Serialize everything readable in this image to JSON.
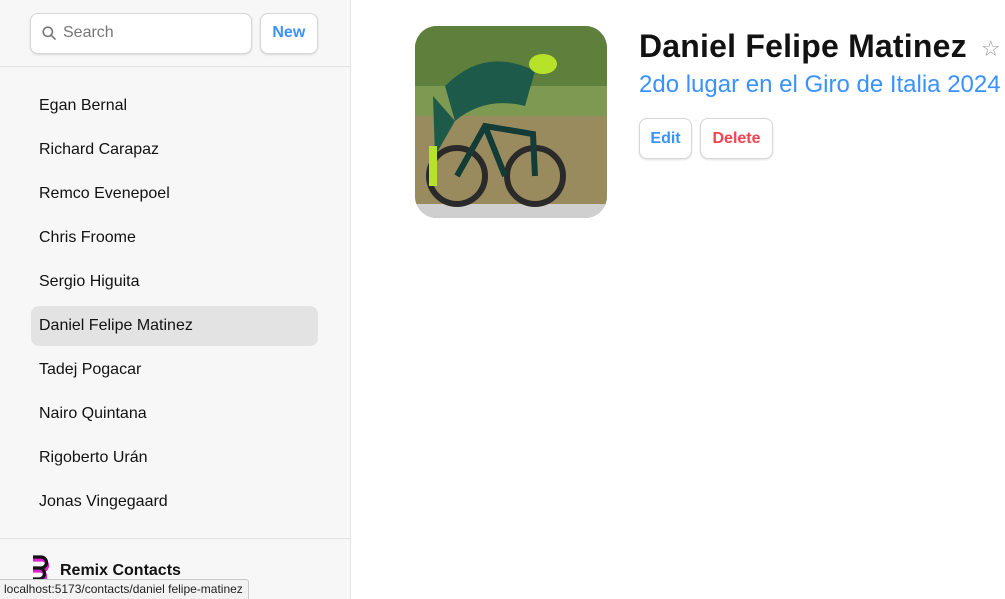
{
  "search": {
    "placeholder": "Search",
    "icon": "search-icon"
  },
  "buttons": {
    "new_label": "New",
    "edit_label": "Edit",
    "delete_label": "Delete"
  },
  "contacts": [
    {
      "name": "Egan Bernal"
    },
    {
      "name": "Richard Carapaz"
    },
    {
      "name": "Remco Evenepoel"
    },
    {
      "name": "Chris Froome"
    },
    {
      "name": "Sergio Higuita"
    },
    {
      "name": "Daniel Felipe Matinez",
      "active": true
    },
    {
      "name": "Tadej Pogacar"
    },
    {
      "name": "Nairo Quintana"
    },
    {
      "name": "Rigoberto Urán"
    },
    {
      "name": "Jonas Vingegaard"
    }
  ],
  "footer": {
    "brand": "Remix Contacts"
  },
  "detail": {
    "name": "Daniel Felipe Matinez",
    "subtitle": "2do lugar en el Giro de Italia 2024",
    "favorite_glyph": "☆"
  },
  "status_bar": {
    "url": "localhost:5173/contacts/daniel felipe-matinez"
  },
  "colors": {
    "accent": "#3992ff",
    "danger": "#f44250",
    "sidebar_bg": "#f7f7f7",
    "active_item": "#e3e3e3"
  }
}
